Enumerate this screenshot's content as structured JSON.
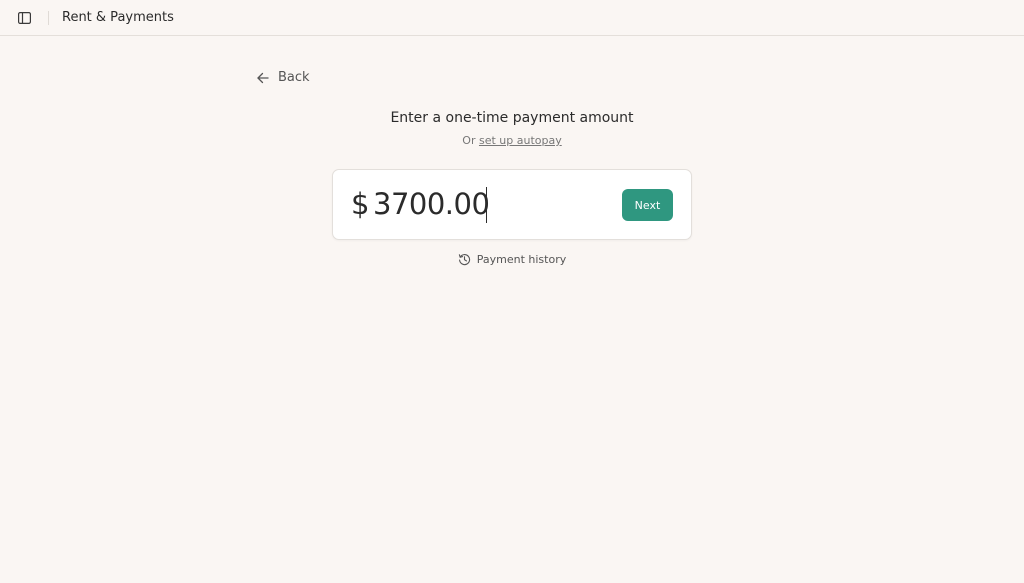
{
  "header": {
    "title": "Rent & Payments",
    "sidebar_toggle_icon": "sidebar-panel-icon"
  },
  "back": {
    "label": "Back",
    "icon": "arrow-left-icon"
  },
  "main": {
    "heading": "Enter a one-time payment amount",
    "subline_prefix": "Or",
    "autopay_link": "set up autopay"
  },
  "amount": {
    "currency_symbol": "$",
    "value": "3700.00"
  },
  "next_button": {
    "label": "Next"
  },
  "history": {
    "label": "Payment history",
    "icon": "history-clock-icon"
  },
  "colors": {
    "accent": "#2f9780",
    "background": "#faf6f3",
    "card": "#ffffff"
  }
}
